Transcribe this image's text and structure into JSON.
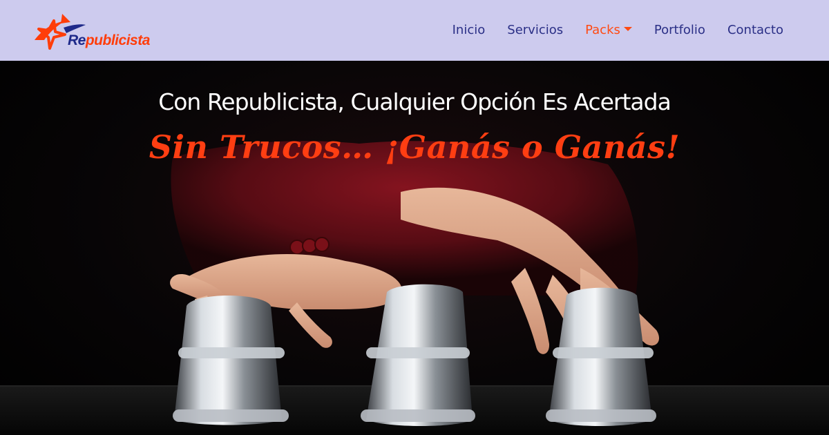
{
  "brand": {
    "name_prefix": "Re",
    "name_rest": "publicista",
    "logo_icon": "star-swoosh-icon",
    "colors": {
      "blue": "#1f2a8a",
      "orange": "#ff3d0a"
    }
  },
  "nav": {
    "items": [
      {
        "label": "Inicio"
      },
      {
        "label": "Servicios"
      },
      {
        "label": "Packs",
        "active": true,
        "dropdown": true
      },
      {
        "label": "Portfolio"
      },
      {
        "label": "Contacto"
      }
    ]
  },
  "hero": {
    "title": "Con Republicista, Cualquier Opción Es Acertada",
    "slogan": "Sin Trucos… ¡Ganás o Ganás!"
  },
  "colors": {
    "navbar_bg": "#cdcbee",
    "nav_text": "#2a2f86",
    "accent": "#ff4a12"
  }
}
